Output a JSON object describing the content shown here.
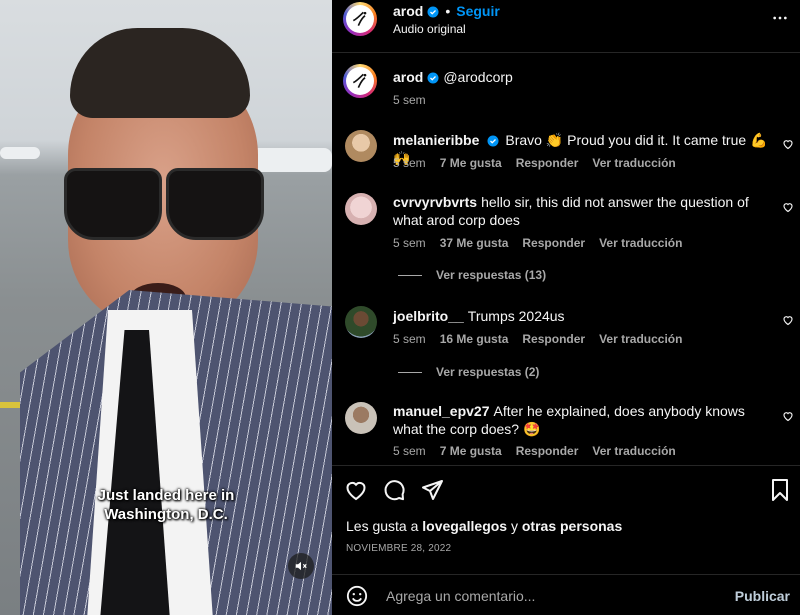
{
  "video": {
    "caption_line1": "Just landed here in",
    "caption_line2": "Washington, D.C.",
    "mute_icon": "speaker-muted-icon"
  },
  "header": {
    "username": "arod",
    "follow_label": "Seguir",
    "separator": "•",
    "audio": "Audio original"
  },
  "post": {
    "username": "arod",
    "handle": "@arodcorp",
    "time": "5 sem"
  },
  "comments": [
    {
      "username": "melanieribbe",
      "verified": true,
      "text": "Bravo 👏 Proud you did it. It came true 💪🙌",
      "time": "5 sem",
      "likes": "7 Me gusta",
      "reply": "Responder",
      "translate": "Ver traducción"
    },
    {
      "username": "cvrvyrvbvrts",
      "text": "hello sir, this did not answer the question of what arod corp does",
      "time": "5 sem",
      "likes": "37 Me gusta",
      "reply": "Responder",
      "translate": "Ver traducción",
      "view_replies": "Ver respuestas (13)"
    },
    {
      "username": "joelbrito__",
      "text": "Trumps 2024us",
      "time": "5 sem",
      "likes": "16 Me gusta",
      "reply": "Responder",
      "translate": "Ver traducción",
      "view_replies": "Ver respuestas (2)"
    },
    {
      "username": "manuel_epv27",
      "text": "After he explained, does anybody knows what the corp does? 🤩",
      "time": "5 sem",
      "likes": "7 Me gusta",
      "reply": "Responder",
      "translate": "Ver traducción"
    }
  ],
  "likes": {
    "prefix": "Les gusta a",
    "user": "lovegallegos",
    "joiner": "y",
    "others": "otras personas"
  },
  "date": "NOVIEMBRE 28, 2022",
  "comment_box": {
    "placeholder": "Agrega un comentario...",
    "publish": "Publicar"
  },
  "colors": {
    "background": "#000000",
    "follow_blue": "#0095f6",
    "verified_blue": "#0095f6",
    "muted_text": "#a8a8a8"
  }
}
